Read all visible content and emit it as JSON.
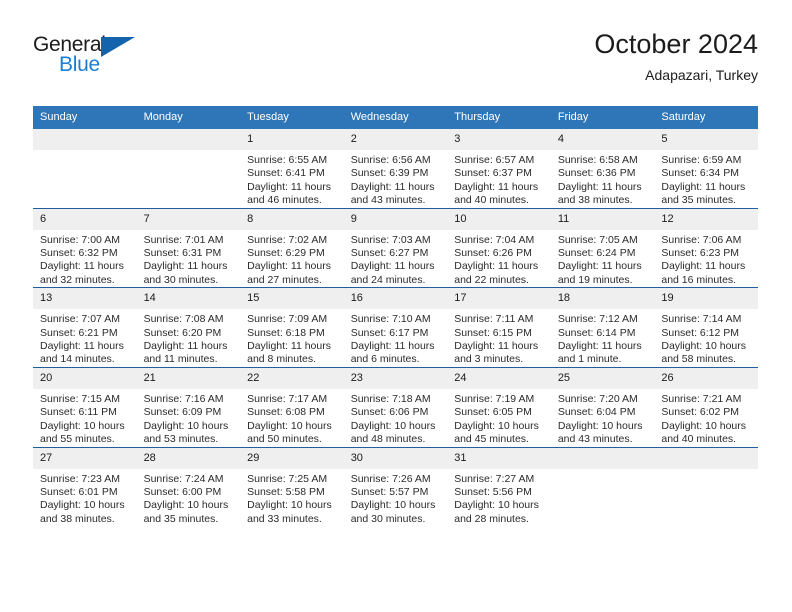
{
  "brand": {
    "name_part1": "General",
    "name_part2": "Blue",
    "logo_icon": "triangle-flag-icon",
    "colors": {
      "dark_text": "#1c1c1c",
      "blue_text": "#1c7fd4",
      "triangle": "#1464ad"
    }
  },
  "header": {
    "title": "October 2024",
    "subtitle": "Adapazari, Turkey"
  },
  "calendar": {
    "header_bg": "#2f76b8",
    "row_divider": "#1f5fa0",
    "daynum_bg": "#efefef",
    "weekdays": [
      "Sunday",
      "Monday",
      "Tuesday",
      "Wednesday",
      "Thursday",
      "Friday",
      "Saturday"
    ],
    "weeks": [
      [
        {
          "day": "",
          "sunrise": "",
          "sunset": "",
          "daylight": "",
          "blank": true
        },
        {
          "day": "",
          "sunrise": "",
          "sunset": "",
          "daylight": "",
          "blank": true
        },
        {
          "day": "1",
          "sunrise": "Sunrise: 6:55 AM",
          "sunset": "Sunset: 6:41 PM",
          "daylight": "Daylight: 11 hours and 46 minutes."
        },
        {
          "day": "2",
          "sunrise": "Sunrise: 6:56 AM",
          "sunset": "Sunset: 6:39 PM",
          "daylight": "Daylight: 11 hours and 43 minutes."
        },
        {
          "day": "3",
          "sunrise": "Sunrise: 6:57 AM",
          "sunset": "Sunset: 6:37 PM",
          "daylight": "Daylight: 11 hours and 40 minutes."
        },
        {
          "day": "4",
          "sunrise": "Sunrise: 6:58 AM",
          "sunset": "Sunset: 6:36 PM",
          "daylight": "Daylight: 11 hours and 38 minutes."
        },
        {
          "day": "5",
          "sunrise": "Sunrise: 6:59 AM",
          "sunset": "Sunset: 6:34 PM",
          "daylight": "Daylight: 11 hours and 35 minutes."
        }
      ],
      [
        {
          "day": "6",
          "sunrise": "Sunrise: 7:00 AM",
          "sunset": "Sunset: 6:32 PM",
          "daylight": "Daylight: 11 hours and 32 minutes."
        },
        {
          "day": "7",
          "sunrise": "Sunrise: 7:01 AM",
          "sunset": "Sunset: 6:31 PM",
          "daylight": "Daylight: 11 hours and 30 minutes."
        },
        {
          "day": "8",
          "sunrise": "Sunrise: 7:02 AM",
          "sunset": "Sunset: 6:29 PM",
          "daylight": "Daylight: 11 hours and 27 minutes."
        },
        {
          "day": "9",
          "sunrise": "Sunrise: 7:03 AM",
          "sunset": "Sunset: 6:27 PM",
          "daylight": "Daylight: 11 hours and 24 minutes."
        },
        {
          "day": "10",
          "sunrise": "Sunrise: 7:04 AM",
          "sunset": "Sunset: 6:26 PM",
          "daylight": "Daylight: 11 hours and 22 minutes."
        },
        {
          "day": "11",
          "sunrise": "Sunrise: 7:05 AM",
          "sunset": "Sunset: 6:24 PM",
          "daylight": "Daylight: 11 hours and 19 minutes."
        },
        {
          "day": "12",
          "sunrise": "Sunrise: 7:06 AM",
          "sunset": "Sunset: 6:23 PM",
          "daylight": "Daylight: 11 hours and 16 minutes."
        }
      ],
      [
        {
          "day": "13",
          "sunrise": "Sunrise: 7:07 AM",
          "sunset": "Sunset: 6:21 PM",
          "daylight": "Daylight: 11 hours and 14 minutes."
        },
        {
          "day": "14",
          "sunrise": "Sunrise: 7:08 AM",
          "sunset": "Sunset: 6:20 PM",
          "daylight": "Daylight: 11 hours and 11 minutes."
        },
        {
          "day": "15",
          "sunrise": "Sunrise: 7:09 AM",
          "sunset": "Sunset: 6:18 PM",
          "daylight": "Daylight: 11 hours and 8 minutes."
        },
        {
          "day": "16",
          "sunrise": "Sunrise: 7:10 AM",
          "sunset": "Sunset: 6:17 PM",
          "daylight": "Daylight: 11 hours and 6 minutes."
        },
        {
          "day": "17",
          "sunrise": "Sunrise: 7:11 AM",
          "sunset": "Sunset: 6:15 PM",
          "daylight": "Daylight: 11 hours and 3 minutes."
        },
        {
          "day": "18",
          "sunrise": "Sunrise: 7:12 AM",
          "sunset": "Sunset: 6:14 PM",
          "daylight": "Daylight: 11 hours and 1 minute."
        },
        {
          "day": "19",
          "sunrise": "Sunrise: 7:14 AM",
          "sunset": "Sunset: 6:12 PM",
          "daylight": "Daylight: 10 hours and 58 minutes."
        }
      ],
      [
        {
          "day": "20",
          "sunrise": "Sunrise: 7:15 AM",
          "sunset": "Sunset: 6:11 PM",
          "daylight": "Daylight: 10 hours and 55 minutes."
        },
        {
          "day": "21",
          "sunrise": "Sunrise: 7:16 AM",
          "sunset": "Sunset: 6:09 PM",
          "daylight": "Daylight: 10 hours and 53 minutes."
        },
        {
          "day": "22",
          "sunrise": "Sunrise: 7:17 AM",
          "sunset": "Sunset: 6:08 PM",
          "daylight": "Daylight: 10 hours and 50 minutes."
        },
        {
          "day": "23",
          "sunrise": "Sunrise: 7:18 AM",
          "sunset": "Sunset: 6:06 PM",
          "daylight": "Daylight: 10 hours and 48 minutes."
        },
        {
          "day": "24",
          "sunrise": "Sunrise: 7:19 AM",
          "sunset": "Sunset: 6:05 PM",
          "daylight": "Daylight: 10 hours and 45 minutes."
        },
        {
          "day": "25",
          "sunrise": "Sunrise: 7:20 AM",
          "sunset": "Sunset: 6:04 PM",
          "daylight": "Daylight: 10 hours and 43 minutes."
        },
        {
          "day": "26",
          "sunrise": "Sunrise: 7:21 AM",
          "sunset": "Sunset: 6:02 PM",
          "daylight": "Daylight: 10 hours and 40 minutes."
        }
      ],
      [
        {
          "day": "27",
          "sunrise": "Sunrise: 7:23 AM",
          "sunset": "Sunset: 6:01 PM",
          "daylight": "Daylight: 10 hours and 38 minutes."
        },
        {
          "day": "28",
          "sunrise": "Sunrise: 7:24 AM",
          "sunset": "Sunset: 6:00 PM",
          "daylight": "Daylight: 10 hours and 35 minutes."
        },
        {
          "day": "29",
          "sunrise": "Sunrise: 7:25 AM",
          "sunset": "Sunset: 5:58 PM",
          "daylight": "Daylight: 10 hours and 33 minutes."
        },
        {
          "day": "30",
          "sunrise": "Sunrise: 7:26 AM",
          "sunset": "Sunset: 5:57 PM",
          "daylight": "Daylight: 10 hours and 30 minutes."
        },
        {
          "day": "31",
          "sunrise": "Sunrise: 7:27 AM",
          "sunset": "Sunset: 5:56 PM",
          "daylight": "Daylight: 10 hours and 28 minutes."
        },
        {
          "day": "",
          "sunrise": "",
          "sunset": "",
          "daylight": "",
          "blank": true
        },
        {
          "day": "",
          "sunrise": "",
          "sunset": "",
          "daylight": "",
          "blank": true
        }
      ]
    ]
  }
}
